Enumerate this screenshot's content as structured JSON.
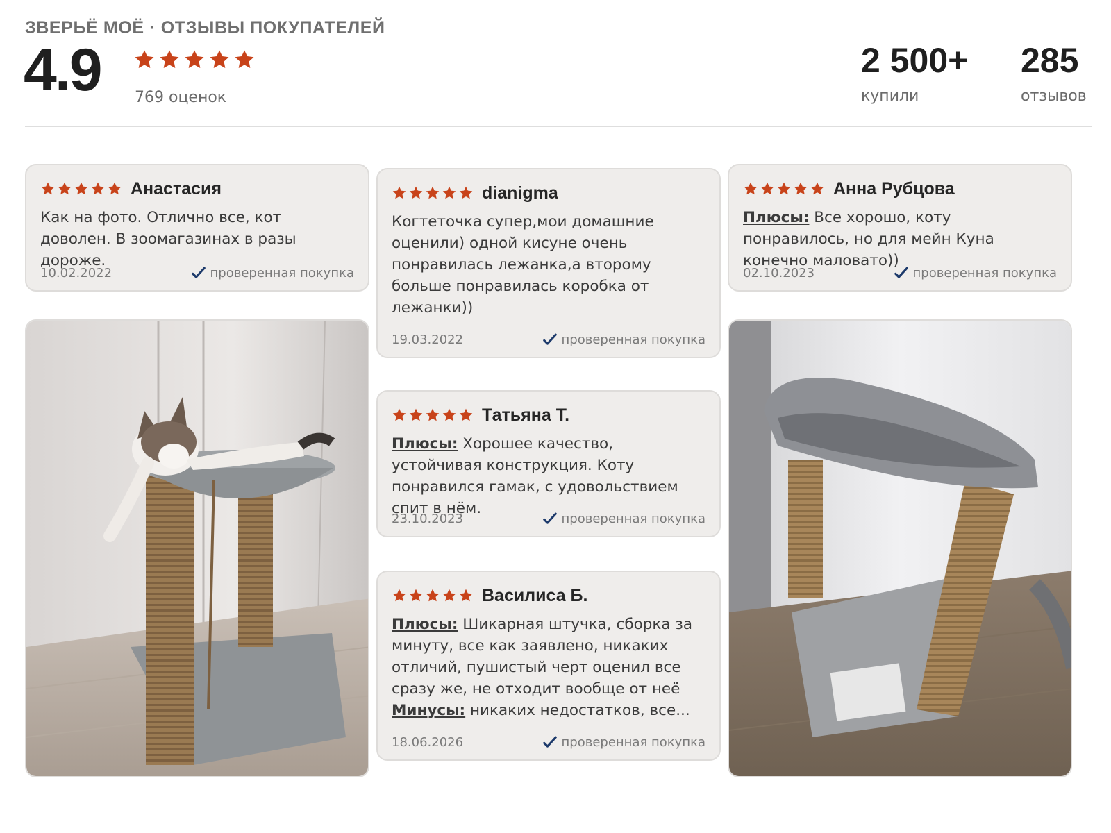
{
  "header": {
    "brand": "ЗВЕРЬЁ МОЁ · ОТЗЫВЫ ПОКУПАТЕЛЕЙ",
    "rating": "4.9",
    "stars": 5,
    "rating_count": "769 оценок",
    "stats": [
      {
        "value": "2 500+",
        "label": "купили"
      },
      {
        "value": "285",
        "label": "отзывов"
      }
    ]
  },
  "colors": {
    "star": "#c8431a",
    "check": "#1d3a6b",
    "card_bg": "#efedeb"
  },
  "icons": {
    "star": "star-icon",
    "check": "checkmark-icon"
  },
  "reviews": [
    {
      "author": "Анастасия",
      "stars": 5,
      "text": "Как на фото. Отлично все, кот доволен. В зоомагазинах в разы дороже.",
      "date": "10.02.2022",
      "verified": "проверенная покупка"
    },
    {
      "author": "dianigma",
      "stars": 5,
      "text": "Когтеточка супер,мои домашние оценили) одной кисуне очень понравилась лежанка,а второму больше понравилась коробка от лежанки))",
      "date": "19.03.2022",
      "verified": "проверенная покупка"
    },
    {
      "author": "Анна Рубцова",
      "stars": 5,
      "pros_label": "Плюсы:",
      "pros": "Все хорошо, коту понравилось, но для мейн Куна конечно маловато))",
      "date": "02.10.2023",
      "verified": "проверенная покупка"
    },
    {
      "author": "Татьяна Т.",
      "stars": 5,
      "pros_label": "Плюсы:",
      "pros": "Хорошее качество, устойчивая конструкция. Коту понравился гамак, с удовольствием спит в нём.",
      "date": "23.10.2023",
      "verified": "проверенная покупка"
    },
    {
      "author": "Василиса Б.",
      "stars": 5,
      "pros_label": "Плюсы:",
      "pros": "Шикарная штучка, сборка за минуту, все как заявлено, никаких отличий, пушистый черт оценил все сразу же, не отходит вообще от неё",
      "cons_label": "Минусы:",
      "cons": "никаких недостатков, все...",
      "date": "18.06.2026",
      "verified": "проверенная покупка"
    }
  ]
}
